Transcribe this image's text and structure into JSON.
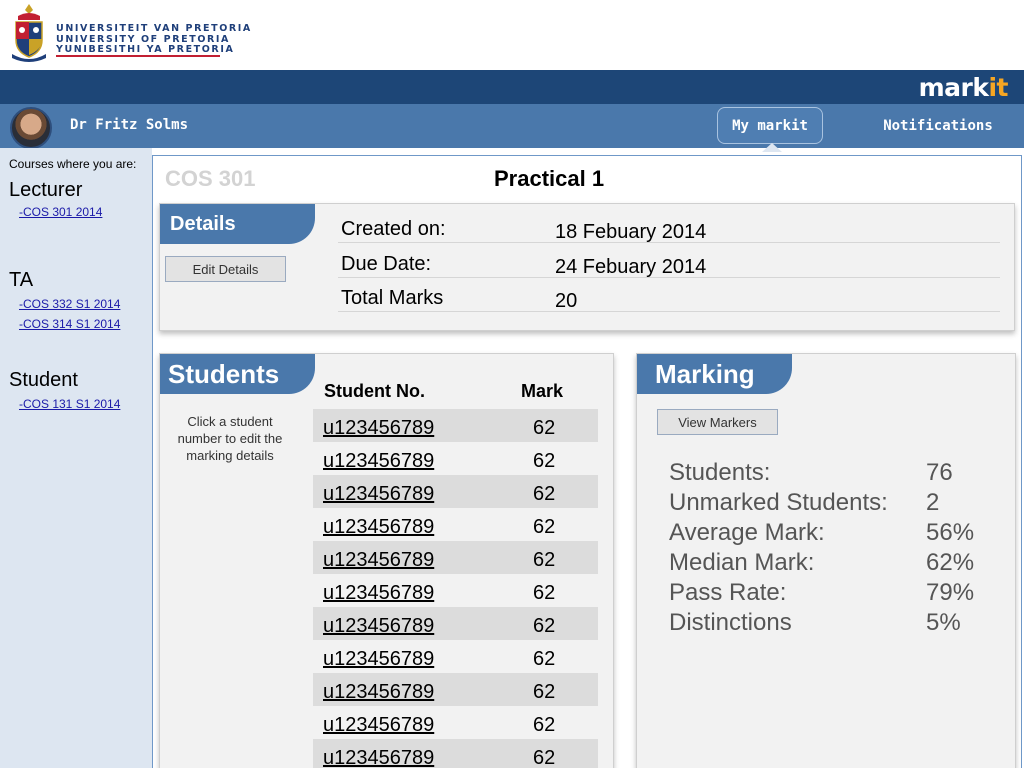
{
  "university": {
    "name_af": "UNIVERSITEIT VAN PRETORIA",
    "name_en": "UNIVERSITY OF PRETORIA",
    "name_nso": "YUNIBESITHI YA PRETORIA"
  },
  "brand": {
    "name_main": "mark",
    "name_accent": "it"
  },
  "user": {
    "name": "Dr Fritz Solms"
  },
  "nav": {
    "my_markit": "My markit",
    "notifications": "Notifications"
  },
  "sidebar": {
    "caption": "Courses where you are:",
    "roles": [
      {
        "title": "Lecturer",
        "links": [
          "-COS 301 2014"
        ]
      },
      {
        "title": "TA",
        "links": [
          "-COS 332 S1 2014",
          "-COS 314 S1 2014"
        ]
      },
      {
        "title": "Student",
        "links": [
          "-COS 131 S1 2014"
        ]
      }
    ]
  },
  "main": {
    "course_code": "COS 301",
    "title": "Practical 1"
  },
  "details": {
    "tab": "Details",
    "edit_button": "Edit Details",
    "rows": [
      {
        "label": "Created on:",
        "value": "18 Febuary 2014"
      },
      {
        "label": "Due Date:",
        "value": "24 Febuary 2014"
      },
      {
        "label": "Total Marks",
        "value": "20"
      }
    ]
  },
  "students": {
    "tab": "Students",
    "hint": "Click a student number to edit the marking details",
    "col_number": "Student No.",
    "col_mark": "Mark",
    "rows": [
      {
        "number": "u123456789",
        "mark": "62"
      },
      {
        "number": "u123456789",
        "mark": "62"
      },
      {
        "number": "u123456789",
        "mark": "62"
      },
      {
        "number": "u123456789",
        "mark": "62"
      },
      {
        "number": "u123456789",
        "mark": "62"
      },
      {
        "number": "u123456789",
        "mark": "62"
      },
      {
        "number": "u123456789",
        "mark": "62"
      },
      {
        "number": "u123456789",
        "mark": "62"
      },
      {
        "number": "u123456789",
        "mark": "62"
      },
      {
        "number": "u123456789",
        "mark": "62"
      },
      {
        "number": "u123456789",
        "mark": "62"
      }
    ]
  },
  "marking": {
    "tab": "Marking",
    "view_button": "View Markers",
    "stats": [
      {
        "label": "Students:",
        "value": "76"
      },
      {
        "label": "Unmarked Students:",
        "value": "2"
      },
      {
        "label": "Average Mark:",
        "value": "56%"
      },
      {
        "label": "Median Mark:",
        "value": "62%"
      },
      {
        "label": "Pass Rate:",
        "value": "79%"
      },
      {
        "label": "Distinctions",
        "value": "5%"
      }
    ]
  },
  "colors": {
    "brand_bar": "#1d4677",
    "nav_bar": "#4a78ab",
    "sidebar_bg": "#dde6f1",
    "logo_accent": "#f6a623"
  }
}
